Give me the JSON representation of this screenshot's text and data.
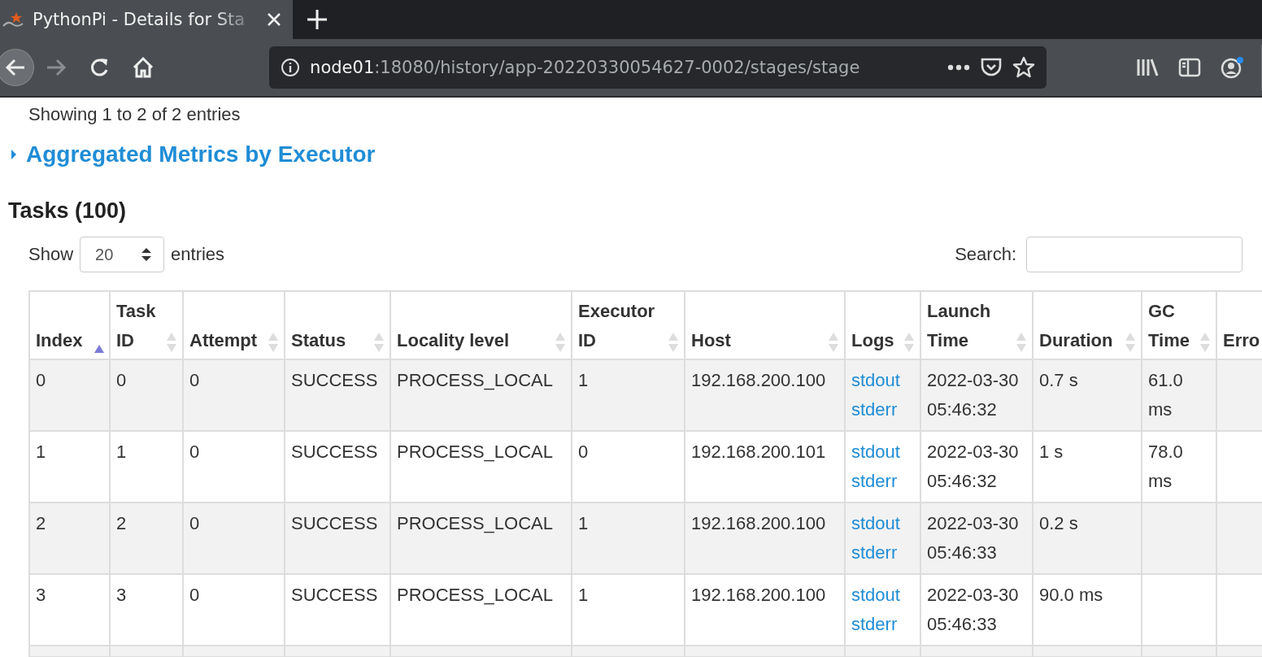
{
  "browser": {
    "tab": {
      "title": "PythonPi - Details for Sta"
    },
    "address": {
      "host": "node01",
      "path": ":18080/history/app-20220330054627-0002/stages/stage"
    }
  },
  "page": {
    "showing": "Showing 1 to 2 of 2 entries",
    "metrics_section": {
      "label": "Aggregated Metrics by Executor",
      "expanded": false
    },
    "tasks_heading": "Tasks (100)",
    "length_control": {
      "before": "Show",
      "value": "20",
      "after": "entries"
    },
    "search": {
      "label": "Search:"
    },
    "table": {
      "columns": [
        {
          "label": "Index",
          "sorted": true
        },
        {
          "label": "Task ID",
          "sorted": false
        },
        {
          "label": "Attempt",
          "sorted": false
        },
        {
          "label": "Status",
          "sorted": false
        },
        {
          "label": "Locality level",
          "sorted": false
        },
        {
          "label": "Executor ID",
          "sorted": false
        },
        {
          "label": "Host",
          "sorted": false
        },
        {
          "label": "Logs",
          "sorted": false
        },
        {
          "label": "Launch Time",
          "sorted": false
        },
        {
          "label": "Duration",
          "sorted": false
        },
        {
          "label": "GC Time",
          "sorted": false
        },
        {
          "label": "Erro"
        }
      ],
      "rows": [
        {
          "cells": [
            "0",
            "0",
            "0",
            "SUCCESS",
            "PROCESS_LOCAL",
            "1",
            "192.168.200.100",
            [
              "stdout",
              "stderr"
            ],
            "2022-03-30 05:46:32",
            "0.7 s",
            "61.0 ms",
            ""
          ]
        },
        {
          "cells": [
            "1",
            "1",
            "0",
            "SUCCESS",
            "PROCESS_LOCAL",
            "0",
            "192.168.200.101",
            [
              "stdout",
              "stderr"
            ],
            "2022-03-30 05:46:32",
            "1 s",
            "78.0 ms",
            ""
          ]
        },
        {
          "cells": [
            "2",
            "2",
            "0",
            "SUCCESS",
            "PROCESS_LOCAL",
            "1",
            "192.168.200.100",
            [
              "stdout",
              "stderr"
            ],
            "2022-03-30 05:46:33",
            "0.2 s",
            "",
            ""
          ]
        },
        {
          "cells": [
            "3",
            "3",
            "0",
            "SUCCESS",
            "PROCESS_LOCAL",
            "1",
            "192.168.200.100",
            [
              "stdout",
              "stderr"
            ],
            "2022-03-30 05:46:33",
            "90.0 ms",
            "",
            ""
          ]
        }
      ]
    }
  }
}
